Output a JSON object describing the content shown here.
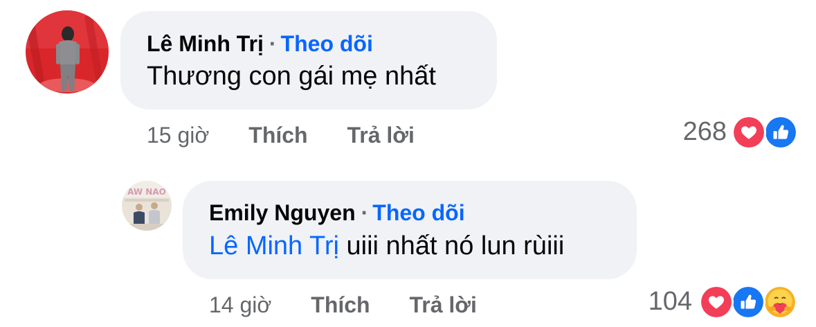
{
  "comments": [
    {
      "author": "Lê Minh Trị",
      "separator": "·",
      "follow_label": "Theo dõi",
      "text": "Thương con gái mẹ nhất",
      "time": "15 giờ",
      "like_label": "Thích",
      "reply_label": "Trả lời",
      "reaction_count": "268",
      "reactions": [
        "heart-icon",
        "like-icon"
      ]
    },
    {
      "author": "Emily Nguyen",
      "separator": "·",
      "follow_label": "Theo dõi",
      "mention": "Lê Minh Trị",
      "text": " uiii nhất nó lun rùiii",
      "time": "14 giờ",
      "like_label": "Thích",
      "reply_label": "Trả lời",
      "reaction_count": "104",
      "reactions": [
        "heart-icon",
        "like-icon",
        "care-icon"
      ]
    }
  ],
  "colors": {
    "accent": "#0866ff",
    "bubble": "#f0f2f5",
    "meta_text": "#65676b",
    "heart": "#f33e58",
    "like": "#1877f2",
    "care": "#f7b125"
  }
}
